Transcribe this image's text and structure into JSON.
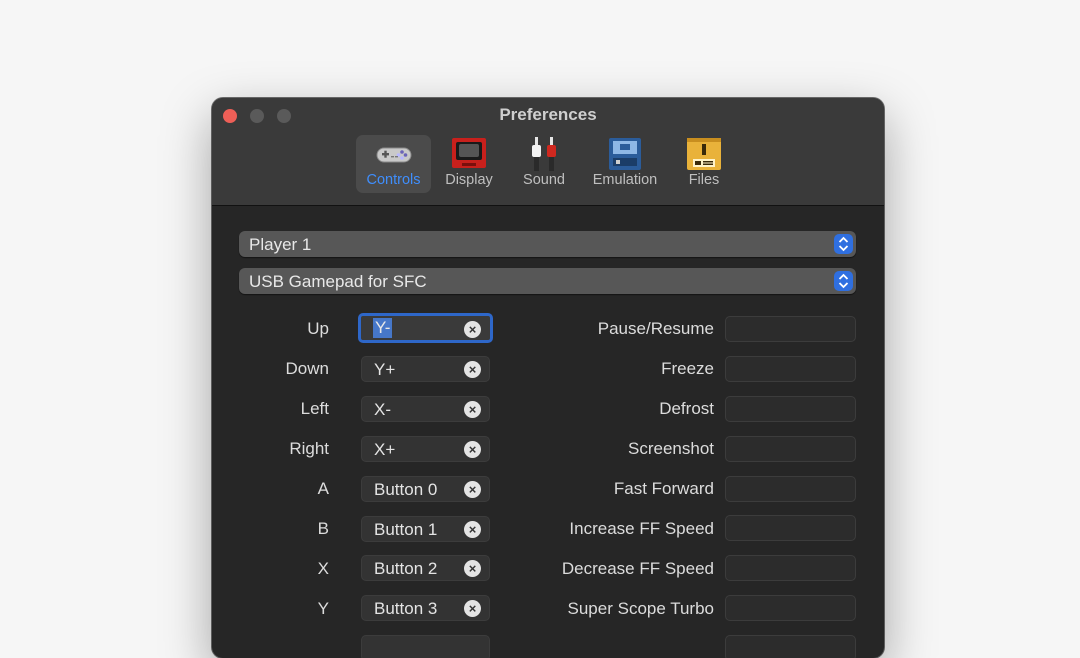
{
  "window": {
    "title": "Preferences"
  },
  "tabs": [
    {
      "label": "Controls",
      "icon": "gamepad-icon",
      "active": true
    },
    {
      "label": "Display",
      "icon": "crt-monitor-icon",
      "active": false
    },
    {
      "label": "Sound",
      "icon": "rca-cables-icon",
      "active": false
    },
    {
      "label": "Emulation",
      "icon": "cartridge-icon",
      "active": false
    },
    {
      "label": "Files",
      "icon": "folder-icon",
      "active": false
    }
  ],
  "player_select": {
    "value": "Player 1"
  },
  "device_select": {
    "value": "USB Gamepad for SFC"
  },
  "bindings": [
    {
      "label": "Up",
      "value": "Y-"
    },
    {
      "label": "Down",
      "value": "Y+"
    },
    {
      "label": "Left",
      "value": "X-"
    },
    {
      "label": "Right",
      "value": "X+"
    },
    {
      "label": "A",
      "value": "Button 0"
    },
    {
      "label": "B",
      "value": "Button 1"
    },
    {
      "label": "X",
      "value": "Button 2"
    },
    {
      "label": "Y",
      "value": "Button 3"
    }
  ],
  "hotkeys": [
    {
      "label": "Pause/Resume",
      "value": ""
    },
    {
      "label": "Freeze",
      "value": ""
    },
    {
      "label": "Defrost",
      "value": ""
    },
    {
      "label": "Screenshot",
      "value": ""
    },
    {
      "label": "Fast Forward",
      "value": ""
    },
    {
      "label": "Increase FF Speed",
      "value": ""
    },
    {
      "label": "Decrease FF Speed",
      "value": ""
    },
    {
      "label": "Super Scope Turbo",
      "value": ""
    }
  ],
  "colors": {
    "accent": "#3f8efc",
    "close": "#ee5f57",
    "focus_ring": "#2e67c9"
  }
}
